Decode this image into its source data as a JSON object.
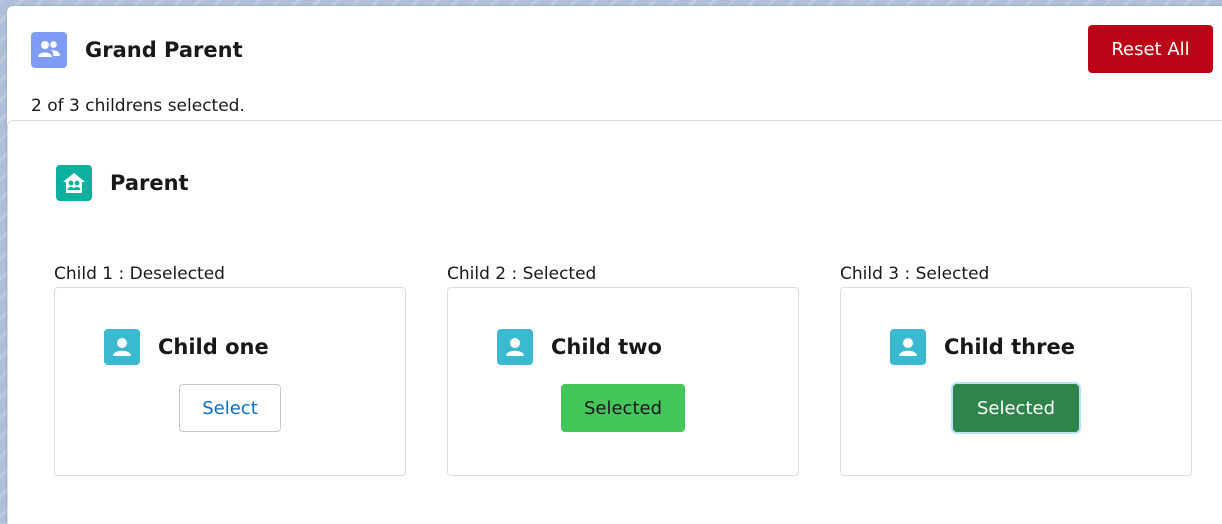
{
  "grand_parent": {
    "title": "Grand Parent",
    "status": "2 of 3 childrens selected.",
    "icon": "groups-icon",
    "reset_label": "Reset All",
    "colors": {
      "icon_bg": "#7f9cf5",
      "reset_bg": "#ba0517"
    }
  },
  "parent": {
    "title": "Parent",
    "icon": "household-icon",
    "colors": {
      "icon_bg": "#0eb0a0"
    }
  },
  "children": [
    {
      "label": "Child 1 : Deselected",
      "name": "Child one",
      "button": "Select",
      "state": "deselected"
    },
    {
      "label": "Child 2 : Selected",
      "name": "Child two",
      "button": "Selected",
      "state": "selected"
    },
    {
      "label": "Child 3 : Selected",
      "name": "Child three",
      "button": "Selected",
      "state": "selected-focused"
    }
  ],
  "child_icon": "user-icon",
  "colors": {
    "child_icon_bg": "#3ab9d0",
    "selected_green": "#45c65a",
    "selected_dark_green": "#2e844a"
  }
}
